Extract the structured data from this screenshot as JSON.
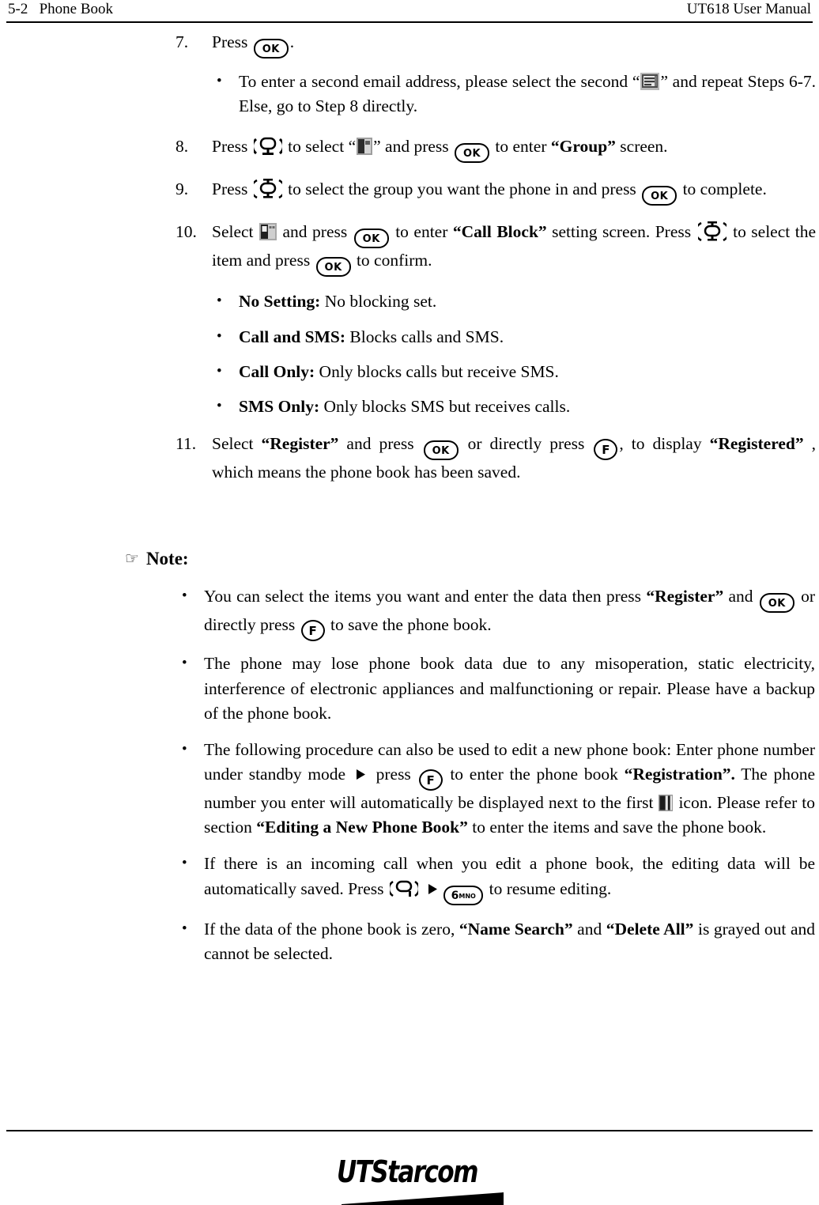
{
  "header": {
    "left": "5-2   Phone Book",
    "right": "UT618 User Manual"
  },
  "steps": [
    {
      "number": "7.",
      "parts": [
        {
          "type": "text",
          "value": "Press "
        },
        {
          "type": "icon",
          "name": "ok-key-icon",
          "label": "OK"
        },
        {
          "type": "text",
          "value": "."
        }
      ],
      "plain": "Press OK."
    },
    {
      "number": "8.",
      "plain": "Press (down-key) to select “(contact-icon)” and press OK to enter “Group” screen."
    },
    {
      "number": "9.",
      "plain": "Press (up-down-key) to select the group you want the phone in and press OK to complete."
    },
    {
      "number": "10.",
      "plain": "Select (call-block-icon) and press OK to enter “Call Block” setting screen. Press (up-down-key) to select the item and press OK to confirm."
    },
    {
      "number": "11.",
      "plain": "Select “Register” and press OK or directly press F, to display “Registered” , which means the phone book has been saved."
    }
  ],
  "step7_bullet": {
    "seg1": "To enter a second email address, please select the second “",
    "seg2": "” and repeat Steps 6-7. Else, go to Step 8 directly."
  },
  "step8": {
    "seg1": "Press ",
    "seg2": " to select “",
    "seg3": "” and press ",
    "seg4": " to enter ",
    "group_label": "“Group”",
    "seg5": " screen."
  },
  "step9": {
    "seg1": "Press ",
    "seg2": " to select the group you want the phone in and press ",
    "seg3": " to complete."
  },
  "step10": {
    "seg1": "Select ",
    "seg2": " and press ",
    "seg3": " to enter ",
    "call_block_label": "“Call Block”",
    "seg4": " setting screen. Press ",
    "seg5": " to select the item and press ",
    "seg6": " to confirm."
  },
  "call_block_options": [
    {
      "term": "No Setting:",
      "desc": " No blocking set."
    },
    {
      "term": "Call and SMS:",
      "desc": " Blocks calls and SMS."
    },
    {
      "term": "Call Only:",
      "desc": " Only blocks calls but receive SMS."
    },
    {
      "term": "SMS Only:",
      "desc": " Only blocks SMS but receives calls."
    }
  ],
  "step11": {
    "seg1": "Select ",
    "register_label": "“Register”",
    "seg2": " and press ",
    "seg3": " or directly press ",
    "seg4": ", to display ",
    "registered_label": "“Registered”",
    "seg5": " , which means the phone book has been saved."
  },
  "note": {
    "heading": "Note:",
    "hand_icon": "pointing-hand-icon",
    "bullets": {
      "b1": {
        "seg1": "You can select the items you want and enter the data then press ",
        "register_label": "“Register”",
        "seg2": " and ",
        "seg3": " or directly press ",
        "seg4": " to save the phone book."
      },
      "b2": {
        "text": "The phone may lose phone book data due to any misoperation, static electricity, interference of electronic appliances and malfunctioning or repair. Please have a backup of the phone book."
      },
      "b3": {
        "seg1": "The following procedure can also be used to edit a new phone book: Enter phone number under standby mode ",
        "seg2": " press ",
        "seg3": " to enter the phone book ",
        "registration_label": "“Registration”.",
        "seg4": " The phone number you enter will automatically be displayed next to the first ",
        "seg5": " icon. Please refer to section ",
        "editing_label": "“Editing a New Phone Book”",
        "seg6": " to enter the items and save the phone book."
      },
      "b4": {
        "seg1": "If there is an incoming call when you edit a phone book, the editing data will be automatically saved. Press ",
        "seg2": " ",
        "seg3": " to resume editing."
      },
      "b5": {
        "seg1": "If the data of the phone book is zero, ",
        "name_search_label": "“Name Search”",
        "seg2": " and ",
        "delete_all_label": "“Delete All”",
        "seg3": " is grayed out and cannot be selected."
      }
    }
  },
  "icons": {
    "ok_label": "OK",
    "f_label": "F",
    "key6_digit": "6",
    "key6_letters": "MNO",
    "bullet_mark": "•",
    "hand": "☞"
  },
  "footer": {
    "logo_ut": "UT",
    "logo_starcom": "Starcom"
  },
  "colors": {
    "text": "#000000",
    "background": "#ffffff",
    "rule": "#000000"
  }
}
